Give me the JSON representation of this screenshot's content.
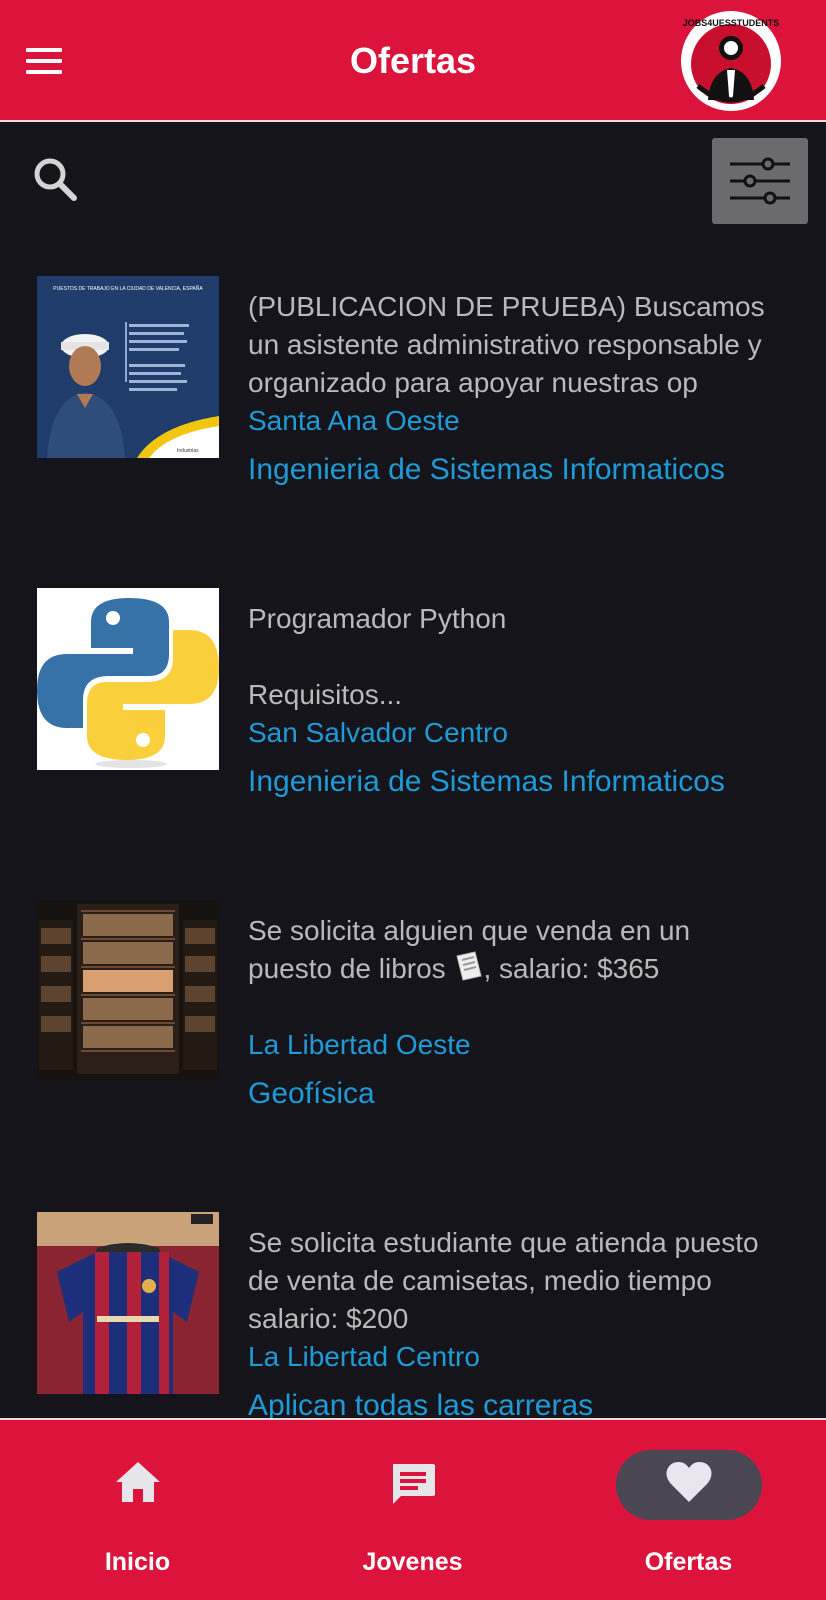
{
  "app": {
    "title": "Ofertas",
    "logo_text": "JOBS4UESSTUDENTS",
    "brand_color": "#dc143c"
  },
  "toolbar": {
    "search_icon": "search-icon",
    "filter_icon": "sliders-icon"
  },
  "offers": [
    {
      "description": "(PUBLICACION DE PRUEBA) Buscamos un asistente administrativo responsable y organizado para apoyar nuestras op",
      "location": "Santa Ana Oeste",
      "career": "Ingenieria de Sistemas Informaticos",
      "image": "construction-worker-flyer",
      "flyer_title": "PUESTOS DE TRABAJO EN LA CIUDAD DE VALENCIA, ESPAÑA",
      "flyer_subtitle": "Industrias"
    },
    {
      "description": "Programador Python\n\nRequisitos...",
      "location": "San Salvador Centro",
      "career": "Ingenieria de Sistemas Informaticos",
      "image": "python-logo"
    },
    {
      "description": "Se solicita alguien que venda en un puesto de libros",
      "description_suffix": ", salario: $365",
      "location": "La Libertad Oeste",
      "career": "Geofísica",
      "image": "library-bookshelf"
    },
    {
      "description": "Se solicita estudiante que atienda puesto de venta de camisetas, medio tiempo salario: $200",
      "location": "La Libertad Centro",
      "career": "Aplican todas las carreras",
      "image": "football-jersey"
    }
  ],
  "bottom_nav": [
    {
      "label": "Inicio",
      "icon": "home-icon"
    },
    {
      "label": "Jovenes",
      "icon": "chat-icon"
    },
    {
      "label": "Ofertas",
      "icon": "heart-icon",
      "active": true
    }
  ]
}
